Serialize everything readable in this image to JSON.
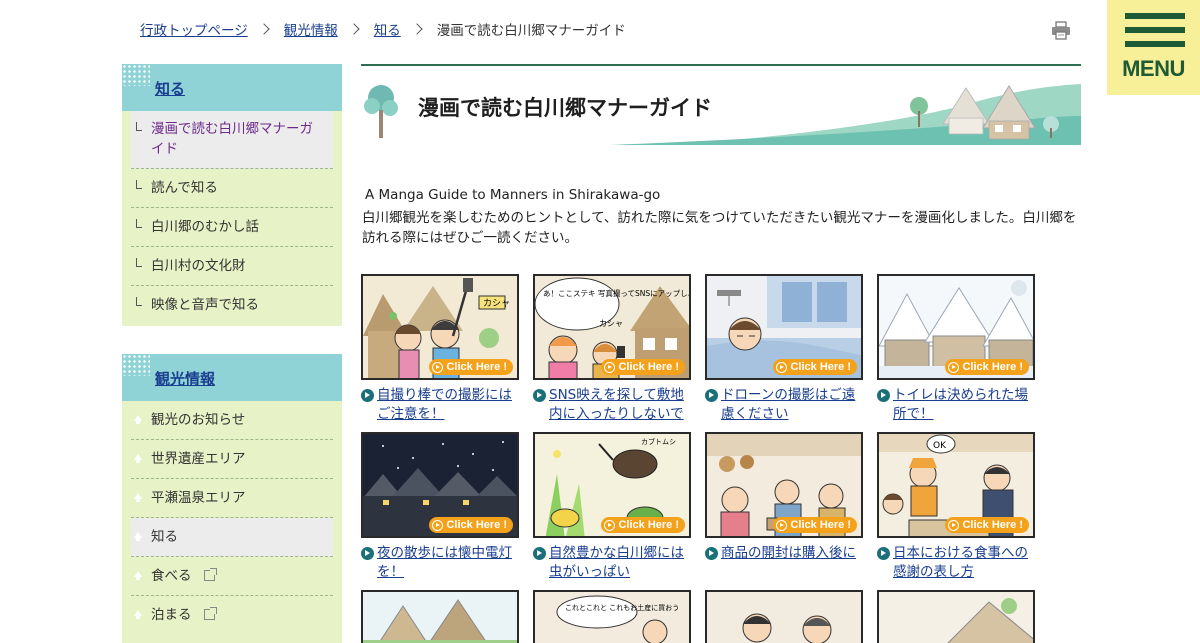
{
  "breadcrumb": {
    "items": [
      "行政トップページ",
      "観光情報",
      "知る"
    ],
    "current": "漫画で読む白川郷マナーガイド"
  },
  "menu": {
    "label": "MENU"
  },
  "sidebar": {
    "section1": {
      "title": "知る",
      "items": [
        "漫画で読む白川郷マナーガイド",
        "読んで知る",
        "白川郷のむかし話",
        "白川村の文化財",
        "映像と音声で知る"
      ]
    },
    "section2": {
      "title": "観光情報",
      "items": [
        "観光のお知らせ",
        "世界遺産エリア",
        "平瀬温泉エリア",
        "知る",
        "食べる",
        "泊まる"
      ]
    }
  },
  "main": {
    "title": "漫画で読む白川郷マナーガイド",
    "intro_en": "A Manga Guide to Manners in Shirakawa-go",
    "intro_ja": "白川郷観光を楽しむためのヒントとして、訪れた際に気をつけていただきたい観光マナーを漫画化しました。白川郷を訪れる際にはぜひご一読ください。",
    "click_label": "Click Here !",
    "manga": [
      {
        "caption": "自撮り棒での撮影にはご注意を！",
        "scene": "selfie"
      },
      {
        "caption": "SNS映えを探して敷地内に入ったりしないで",
        "scene": "sns"
      },
      {
        "caption": "ドローンの撮影はご遠慮ください",
        "scene": "drone"
      },
      {
        "caption": "トイレは決められた場所で！",
        "scene": "snow"
      },
      {
        "caption": "夜の散歩には懐中電灯を！",
        "scene": "night"
      },
      {
        "caption": "自然豊かな白川郷には虫がいっぱい",
        "scene": "bugs"
      },
      {
        "caption": "商品の開封は購入後に",
        "scene": "shop"
      },
      {
        "caption": "日本における食事への感謝の表し方",
        "scene": "meal"
      }
    ],
    "bubbles": {
      "sns": "あ！ここステキ 写真撮ってSNSにアップしよ〜",
      "selfie_sfx": "カシャ",
      "sns_sfx": "カシャ",
      "meal_ok": "OK",
      "bugs_sfx": "カブトムシ",
      "row3_card2": "これとこれと これもお土産に買おう"
    }
  }
}
